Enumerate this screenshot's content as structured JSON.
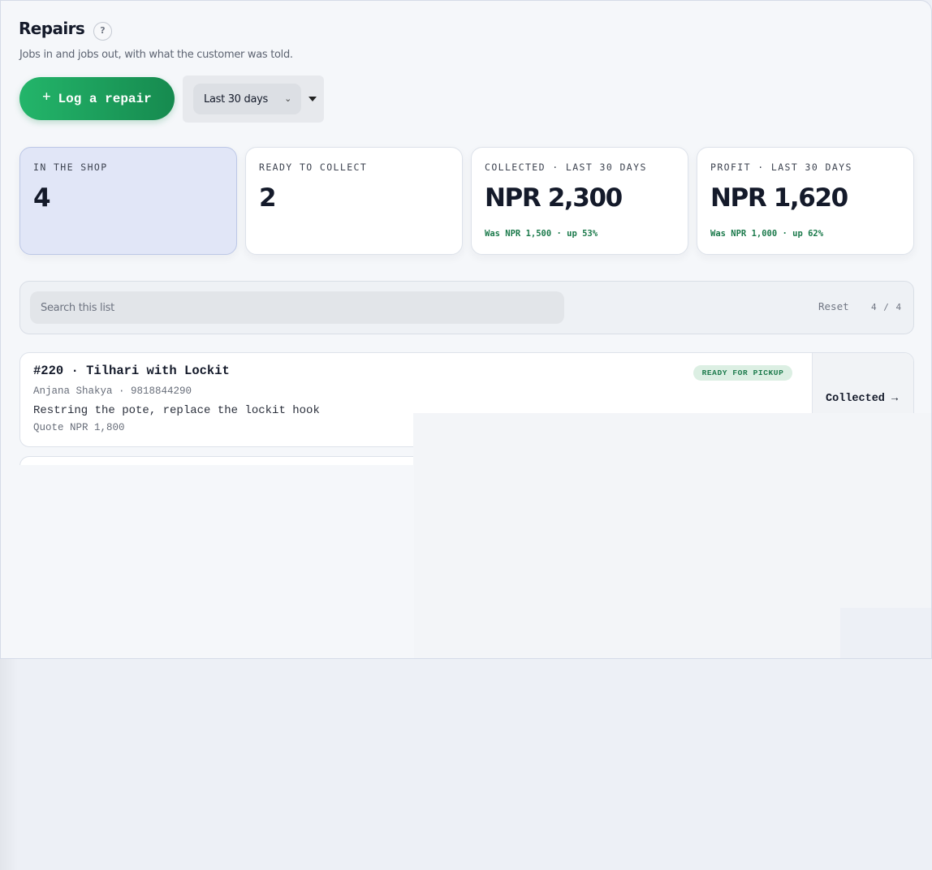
{
  "header": {
    "title": "Repairs",
    "help_icon": "?",
    "subtitle": "Jobs in and jobs out, with what the customer was told."
  },
  "toolbar": {
    "log_button_icon": "+",
    "log_button_label": "Log a repair",
    "range_value": "Last 30 days",
    "range_chevron": "⌄"
  },
  "stats": [
    {
      "label": "IN THE SHOP",
      "value": "4",
      "delta": ""
    },
    {
      "label": "READY TO COLLECT",
      "value": "2",
      "delta": ""
    },
    {
      "label": "COLLECTED · LAST 30 DAYS",
      "value": "NPR 2,300",
      "delta": "Was NPR 1,500 · up 53%"
    },
    {
      "label": "PROFIT · LAST 30 DAYS",
      "value": "NPR 1,620",
      "delta": "Was NPR 1,000 · up 62%"
    }
  ],
  "filter": {
    "search_placeholder": "Search this list",
    "reset_label": "Reset",
    "count": "4 / 4"
  },
  "repairs": [
    {
      "title": "#220 · Tilhari with Lockit",
      "customer": "Anjana Shakya · 9818844290",
      "description": "Restring the pote, replace the lockit hook",
      "quote": "Quote NPR 1,800",
      "status": "READY FOR PICKUP",
      "action": "Collected →"
    }
  ],
  "colors": {
    "accent_green": "#1b9a5a",
    "status_green": "#1b7a4b",
    "active_card": "#e1e6f7"
  }
}
